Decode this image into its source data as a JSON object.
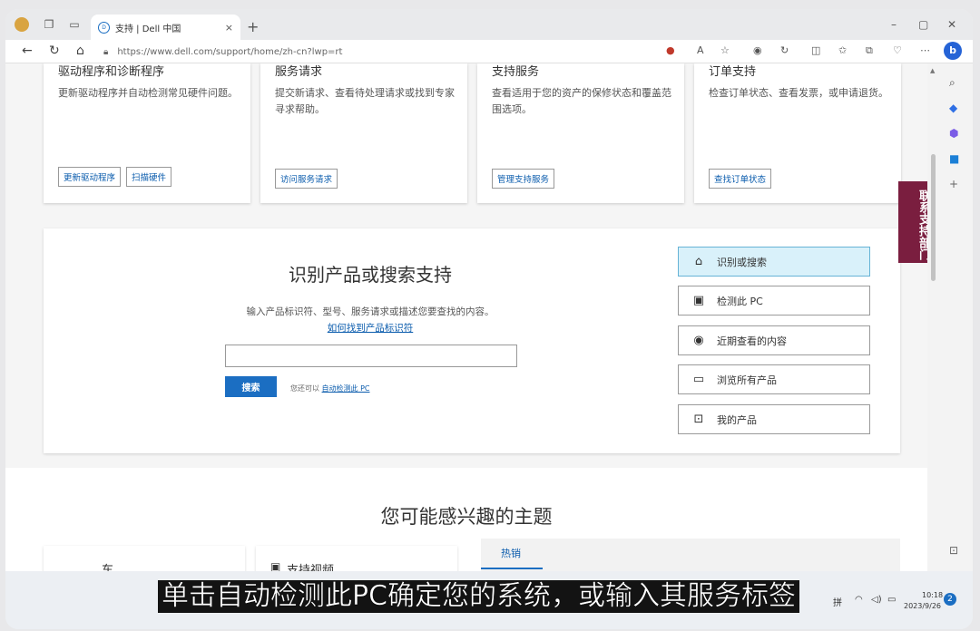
{
  "browser": {
    "tab_title": "支持 | Dell 中国",
    "tab_close": "×",
    "new_tab": "+",
    "url": "https://www.dell.com/support/home/zh-cn?lwp=rt",
    "win_min": "–",
    "win_max": "▢",
    "win_close": "✕",
    "read_aloud": "A",
    "notification_count": "2"
  },
  "cards": [
    {
      "title": "驱动程序和诊断程序",
      "desc": "更新驱动程序并自动检测常见硬件问题。",
      "buttons": [
        "更新驱动程序",
        "扫描硬件"
      ]
    },
    {
      "title": "服务请求",
      "desc": "提交新请求、查看待处理请求或找到专家寻求帮助。",
      "buttons": [
        "访问服务请求"
      ]
    },
    {
      "title": "支持服务",
      "desc": "查看适用于您的资产的保修状态和覆盖范围选项。",
      "buttons": [
        "管理支持服务"
      ]
    },
    {
      "title": "订单支持",
      "desc": "检查订单状态、查看发票，或申请退货。",
      "buttons": [
        "查找订单状态"
      ]
    }
  ],
  "identify": {
    "title": "识别产品或搜索支持",
    "desc": "输入产品标识符、型号、服务请求或描述您要查找的内容。",
    "link": "如何找到产品标识符",
    "search_placeholder": "",
    "search_button": "搜索",
    "hint_prefix": "您还可以",
    "hint_link": "自动检测此 PC"
  },
  "options": [
    {
      "label": "识别或搜索",
      "icon": "tag-icon",
      "selected": true
    },
    {
      "label": "检测此 PC",
      "icon": "pc-scan-icon",
      "selected": false
    },
    {
      "label": "近期查看的内容",
      "icon": "eye-icon",
      "selected": false
    },
    {
      "label": "浏览所有产品",
      "icon": "laptop-icon",
      "selected": false
    },
    {
      "label": "我的产品",
      "icon": "lock-icon",
      "selected": false
    }
  ],
  "side_tab": "联系支持部门",
  "topics": {
    "title": "您可能感兴趣的主题",
    "tile1": "车",
    "tile2": "支持视频",
    "hot_tab": "热销"
  },
  "subtitle": "单击自动检测此PC确定您的系统，或输入其服务标签",
  "tray": {
    "ime": "拼",
    "time": "10:18",
    "date": "2023/9/26"
  },
  "colors": {
    "accent": "#1b6ec2",
    "side_tab": "#7a1e3f",
    "selected_option": "#d9f1fa"
  }
}
